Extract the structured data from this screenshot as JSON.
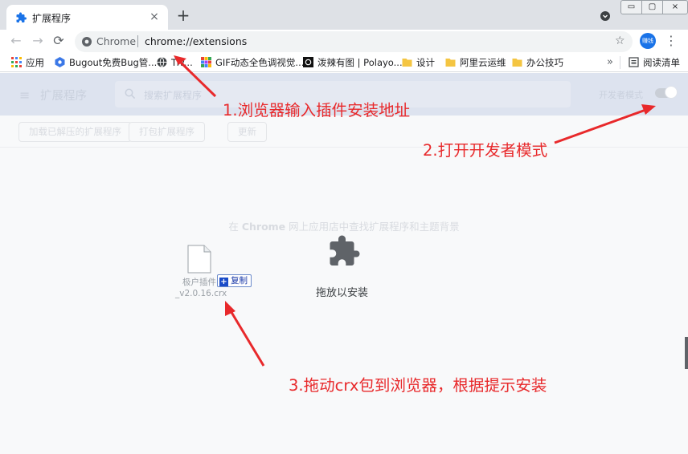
{
  "tab": {
    "title": "扩展程序",
    "close": "×",
    "new_tab": "+"
  },
  "window": {
    "minimize": "▭",
    "maximize": "▢",
    "close": "×"
  },
  "omnibox": {
    "chip": "Chrome",
    "url": "chrome://extensions",
    "star": "☆"
  },
  "toolbar": {
    "back": "←",
    "forward": "→",
    "reload": "⟳",
    "avatar": "赚钱",
    "menu": "⋮"
  },
  "bookmarks": {
    "items": [
      {
        "label": "应用",
        "icon": "apps-grid-icon"
      },
      {
        "label": "Bugout免费Bug管...",
        "icon": "bugout-icon"
      },
      {
        "label": "Tiv...",
        "icon": "globe-icon"
      },
      {
        "label": "GIF动态全色调视觉...",
        "icon": "gif-icon"
      },
      {
        "label": "泼辣有图 | Polayo...",
        "icon": "polayo-icon"
      },
      {
        "label": "设计",
        "icon": "folder-icon"
      },
      {
        "label": "阿里云运维",
        "icon": "folder-icon"
      },
      {
        "label": "办公技巧",
        "icon": "folder-icon"
      }
    ],
    "more": "»",
    "reading_list": "阅读清单"
  },
  "extensions_page": {
    "menu": "≡",
    "title": "扩展程序",
    "search_placeholder": "搜索扩展程序",
    "dev_mode_label": "开发者模式",
    "dev_mode_on": false,
    "buttons": [
      "加载已解压的扩展程序",
      "打包扩展程序",
      "更新"
    ],
    "store_hint_prefix": "在 ",
    "store_hint_link": "Chrome",
    "store_hint_suffix": " 网上应用店中查找扩展程序和主题背景",
    "drop_text": "拖放以安装"
  },
  "dragged_file": {
    "name_line1": "极户插件",
    "name_line2": "_v2.0.16.crx",
    "badge_plus": "+",
    "badge_label": "复制"
  },
  "annotations": {
    "step1": "1.浏览器输入插件安装地址",
    "step2": "2.打开开发者模式",
    "step3": "3.拖动crx包到浏览器，根据提示安装"
  },
  "colors": {
    "annotation_red": "#e8292b",
    "chrome_blue": "#1a73e8",
    "tabstrip_gray": "#dee1e6"
  }
}
